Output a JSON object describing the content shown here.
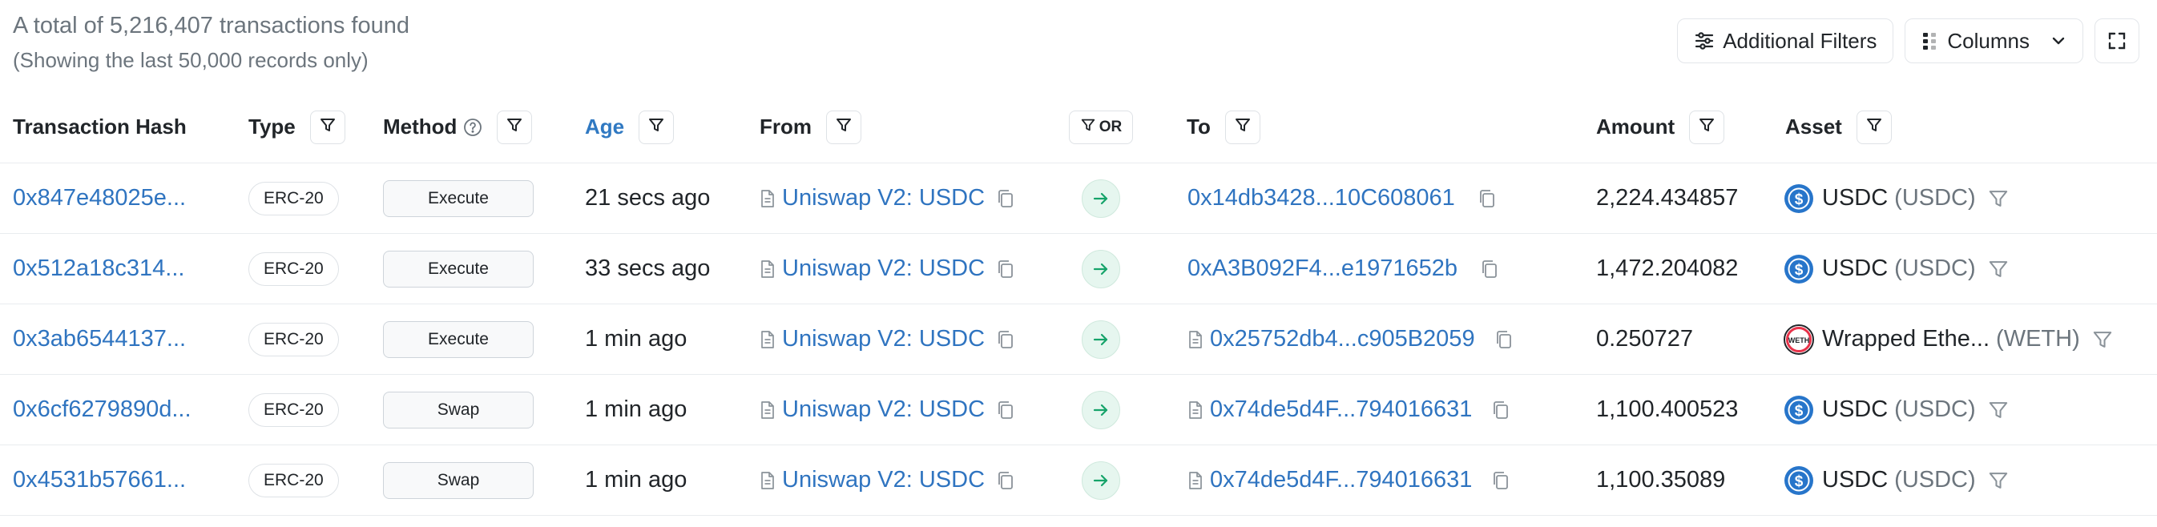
{
  "summary": {
    "total": "A total of 5,216,407 transactions found",
    "note": "(Showing the last 50,000 records only)"
  },
  "toolbar": {
    "additional_filters": "Additional Filters",
    "columns": "Columns"
  },
  "columns": {
    "hash": "Transaction Hash",
    "type": "Type",
    "method": "Method",
    "age": "Age",
    "from": "From",
    "or": "OR",
    "to": "To",
    "amount": "Amount",
    "asset": "Asset"
  },
  "colors": {
    "link": "#2f74c0",
    "muted": "#6c757d",
    "arrow_bg": "#e6f6ef",
    "usdc": "#2775ca"
  },
  "rows": [
    {
      "hash": "0x847e48025e...",
      "type": "ERC-20",
      "method": "Execute",
      "age": "21 secs ago",
      "from": "Uniswap V2: USDC",
      "to": "0x14db3428...10C608061",
      "to_is_contract": false,
      "amount": "2,224.434857",
      "asset_name": "USDC",
      "asset_symbol": "(USDC)",
      "asset_icon": "usdc-icon"
    },
    {
      "hash": "0x512a18c314...",
      "type": "ERC-20",
      "method": "Execute",
      "age": "33 secs ago",
      "from": "Uniswap V2: USDC",
      "to": "0xA3B092F4...e1971652b",
      "to_is_contract": false,
      "amount": "1,472.204082",
      "asset_name": "USDC",
      "asset_symbol": "(USDC)",
      "asset_icon": "usdc-icon"
    },
    {
      "hash": "0x3ab6544137...",
      "type": "ERC-20",
      "method": "Execute",
      "age": "1 min ago",
      "from": "Uniswap V2: USDC",
      "to": "0x25752db4...c905B2059",
      "to_is_contract": true,
      "amount": "0.250727",
      "asset_name": "Wrapped Ethe...",
      "asset_symbol": "(WETH)",
      "asset_icon": "weth-icon"
    },
    {
      "hash": "0x6cf6279890d...",
      "type": "ERC-20",
      "method": "Swap",
      "age": "1 min ago",
      "from": "Uniswap V2: USDC",
      "to": "0x74de5d4F...794016631",
      "to_is_contract": true,
      "amount": "1,100.400523",
      "asset_name": "USDC",
      "asset_symbol": "(USDC)",
      "asset_icon": "usdc-icon"
    },
    {
      "hash": "0x4531b57661...",
      "type": "ERC-20",
      "method": "Swap",
      "age": "1 min ago",
      "from": "Uniswap V2: USDC",
      "to": "0x74de5d4F...794016631",
      "to_is_contract": true,
      "amount": "1,100.35089",
      "asset_name": "USDC",
      "asset_symbol": "(USDC)",
      "asset_icon": "usdc-icon"
    }
  ]
}
